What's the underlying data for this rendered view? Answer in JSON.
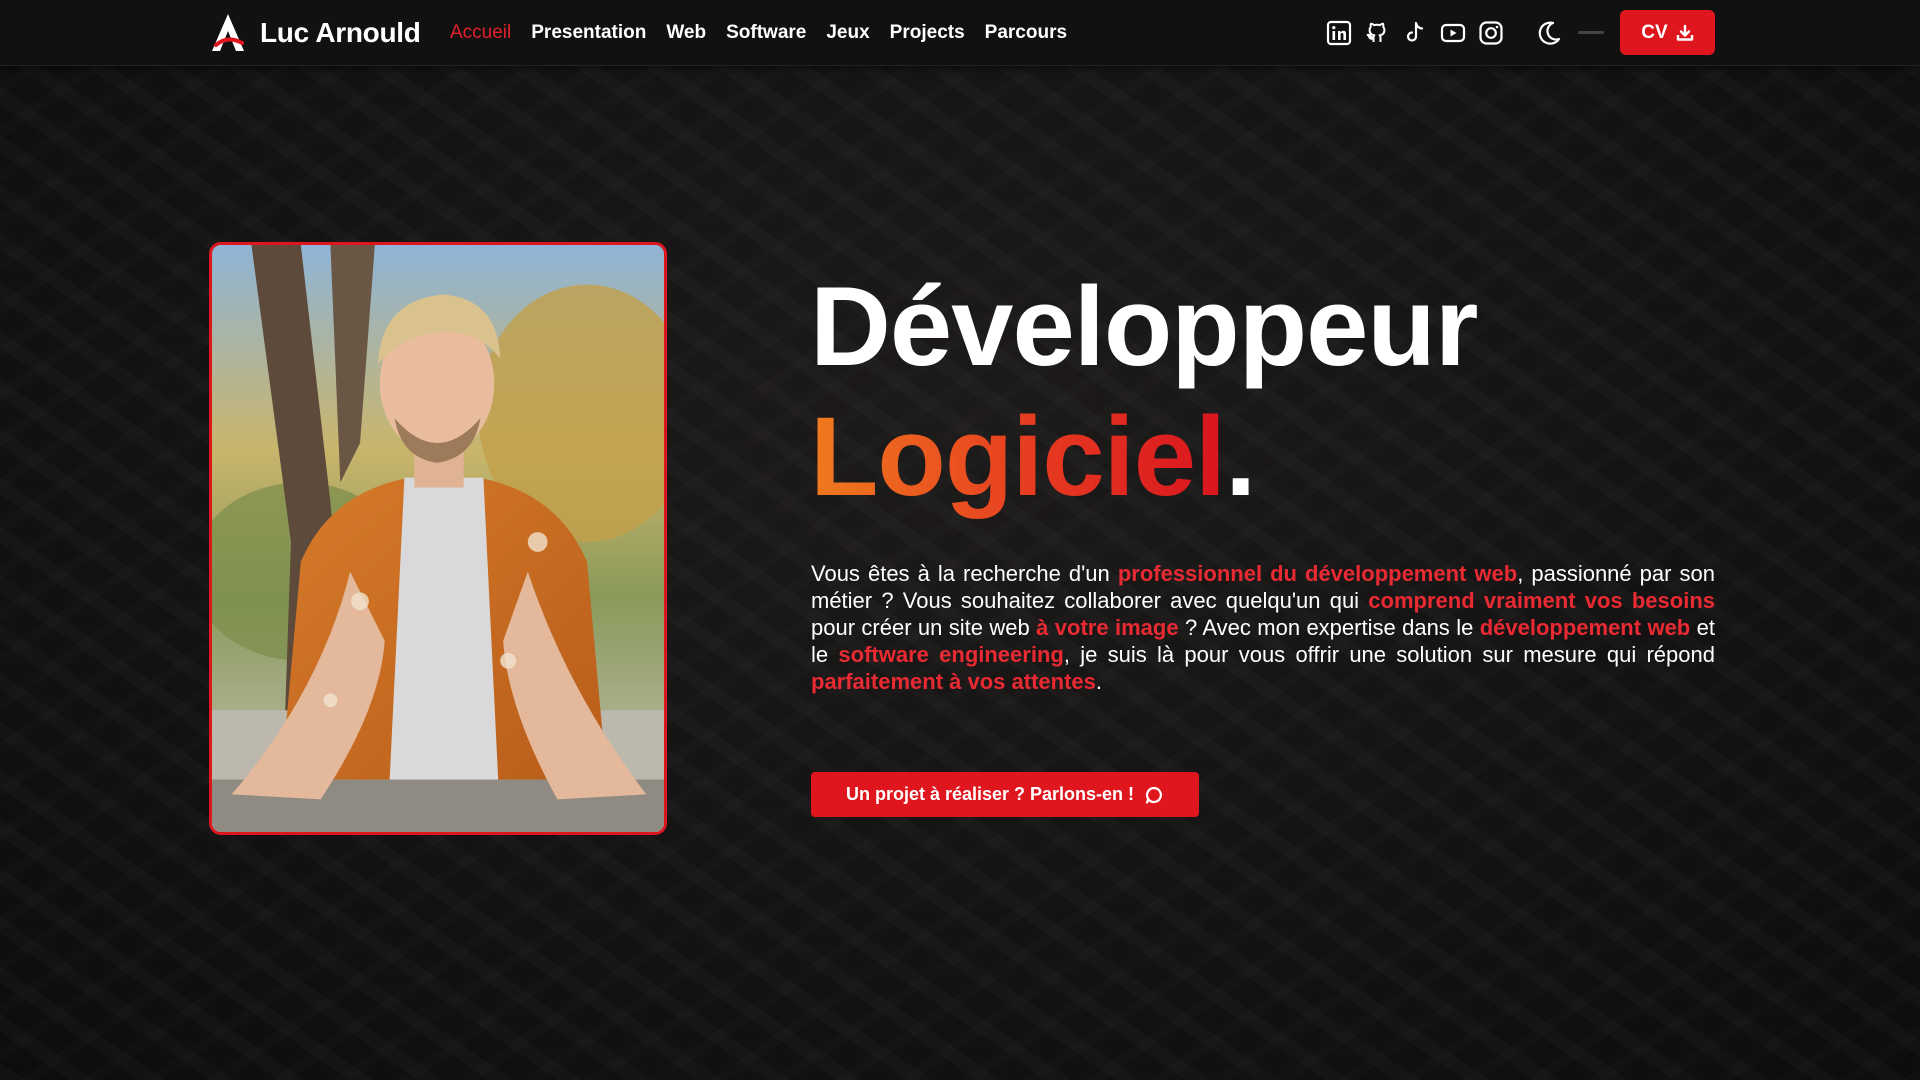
{
  "brand": {
    "name": "Luc Arnould",
    "logo_icon": "a-logo-icon"
  },
  "nav": {
    "links": [
      {
        "label": "Accueil",
        "active": true
      },
      {
        "label": "Presentation",
        "active": false
      },
      {
        "label": "Web",
        "active": false
      },
      {
        "label": "Software",
        "active": false
      },
      {
        "label": "Jeux",
        "active": false
      },
      {
        "label": "Projects",
        "active": false
      },
      {
        "label": "Parcours",
        "active": false
      }
    ],
    "social_icons": [
      "linkedin-icon",
      "github-icon",
      "tiktok-icon",
      "youtube-icon",
      "instagram-icon"
    ],
    "theme_icon": "moon-icon",
    "cv_label": "CV",
    "cv_icon": "download-icon"
  },
  "hero": {
    "title_line1": "Développeur",
    "title_line2": "Logiciel",
    "title_dot": ".",
    "intro": [
      {
        "text": "Vous êtes à la recherche d'un ",
        "highlight": false
      },
      {
        "text": "professionnel du développement web",
        "highlight": true
      },
      {
        "text": ", passionné par son métier ? Vous souhaitez collaborer avec quelqu'un qui ",
        "highlight": false
      },
      {
        "text": "comprend vraiment vos besoins",
        "highlight": true
      },
      {
        "text": " pour créer un site web ",
        "highlight": false
      },
      {
        "text": "à votre image",
        "highlight": true
      },
      {
        "text": " ? Avec mon expertise dans le ",
        "highlight": false
      },
      {
        "text": "développement web",
        "highlight": true
      },
      {
        "text": " et le ",
        "highlight": false
      },
      {
        "text": "software engineering",
        "highlight": true
      },
      {
        "text": ", je suis là pour vous offrir une solution sur mesure qui répond ",
        "highlight": false
      },
      {
        "text": "parfaitement à vos attentes",
        "highlight": true
      },
      {
        "text": ".",
        "highlight": false
      }
    ],
    "cta_label": "Un projet à réaliser ? Parlons-en !",
    "cta_icon": "chat-bubble-icon"
  },
  "colors": {
    "accent": "#e0161f",
    "highlight": "#ea2a33",
    "gradient_start": "#f07a1e",
    "background": "#141212"
  }
}
